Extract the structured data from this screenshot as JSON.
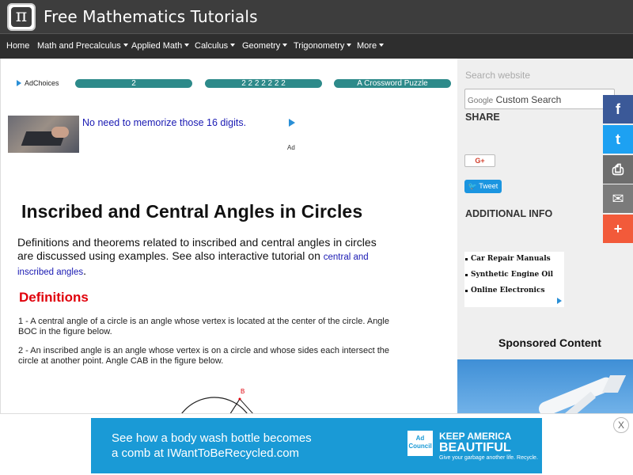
{
  "header": {
    "logo_glyph": "π",
    "site_title": "Free Mathematics Tutorials"
  },
  "nav": {
    "items": [
      {
        "label": "Home",
        "has_caret": false
      },
      {
        "label": "Math and Precalculus",
        "has_caret": true
      },
      {
        "label": "Applied Math",
        "has_caret": true
      },
      {
        "label": "Calculus",
        "has_caret": true
      },
      {
        "label": "Geometry",
        "has_caret": true
      },
      {
        "label": "Trigonometry",
        "has_caret": true
      },
      {
        "label": "More",
        "has_caret": true
      }
    ]
  },
  "ads": {
    "adchoices_label": "AdChoices",
    "pills": [
      "2",
      "2 2 2 2 2 2 2",
      "A Crossword Puzzle"
    ],
    "banner_text": "No need to memorize those 16 digits.",
    "banner_label": "Ad"
  },
  "article": {
    "title": "Inscribed and Central Angles in Circles",
    "intro_text": "Definitions and theorems related to inscribed and central angles in circles are discussed using examples. See also interactive tutorial on ",
    "intro_link": "central and inscribed angles",
    "intro_end": ".",
    "definitions_heading": "Definitions",
    "definition_1": "1 - A central angle of a circle is an angle whose vertex is located at the center of the circle. Angle BOC in the figure below.",
    "definition_2": "2 - An inscribed angle is an angle whose vertex is on a circle and whose sides each intersect the circle at another point. Angle CAB in the figure below.",
    "figure_label_b": "B"
  },
  "sidebar": {
    "search_label": "Search website",
    "search_prefix": "Google",
    "search_placeholder": "Custom Search",
    "share_heading": "SHARE",
    "gplus_label": "G+",
    "tweet_label": "Tweet",
    "additional_heading": "ADDITIONAL INFO",
    "link_ads": [
      "Car Repair Manuals",
      "Synthetic Engine Oil",
      "Online Electronics"
    ],
    "sponsored_heading": "Sponsored Content"
  },
  "social": {
    "facebook_glyph": "f",
    "twitter_glyph": "t",
    "print_glyph": "⎙",
    "email_glyph": "✉",
    "more_glyph": "+",
    "colors": {
      "facebook": "#3b5998",
      "twitter": "#1da1f2",
      "print": "#6d6d6d",
      "email": "#7b7b7b",
      "more": "#f25a3a"
    }
  },
  "bottom_ad": {
    "line1": "See how a body wash bottle becomes",
    "line2": "a comb at IWantToBeRecycled.com",
    "brand_box": "Ad Council",
    "keep_line1": "KEEP AMERICA",
    "keep_line2": "BEAUTIFUL",
    "keep_line3": "Give your garbage another life. Recycle.",
    "close_glyph": "X"
  }
}
